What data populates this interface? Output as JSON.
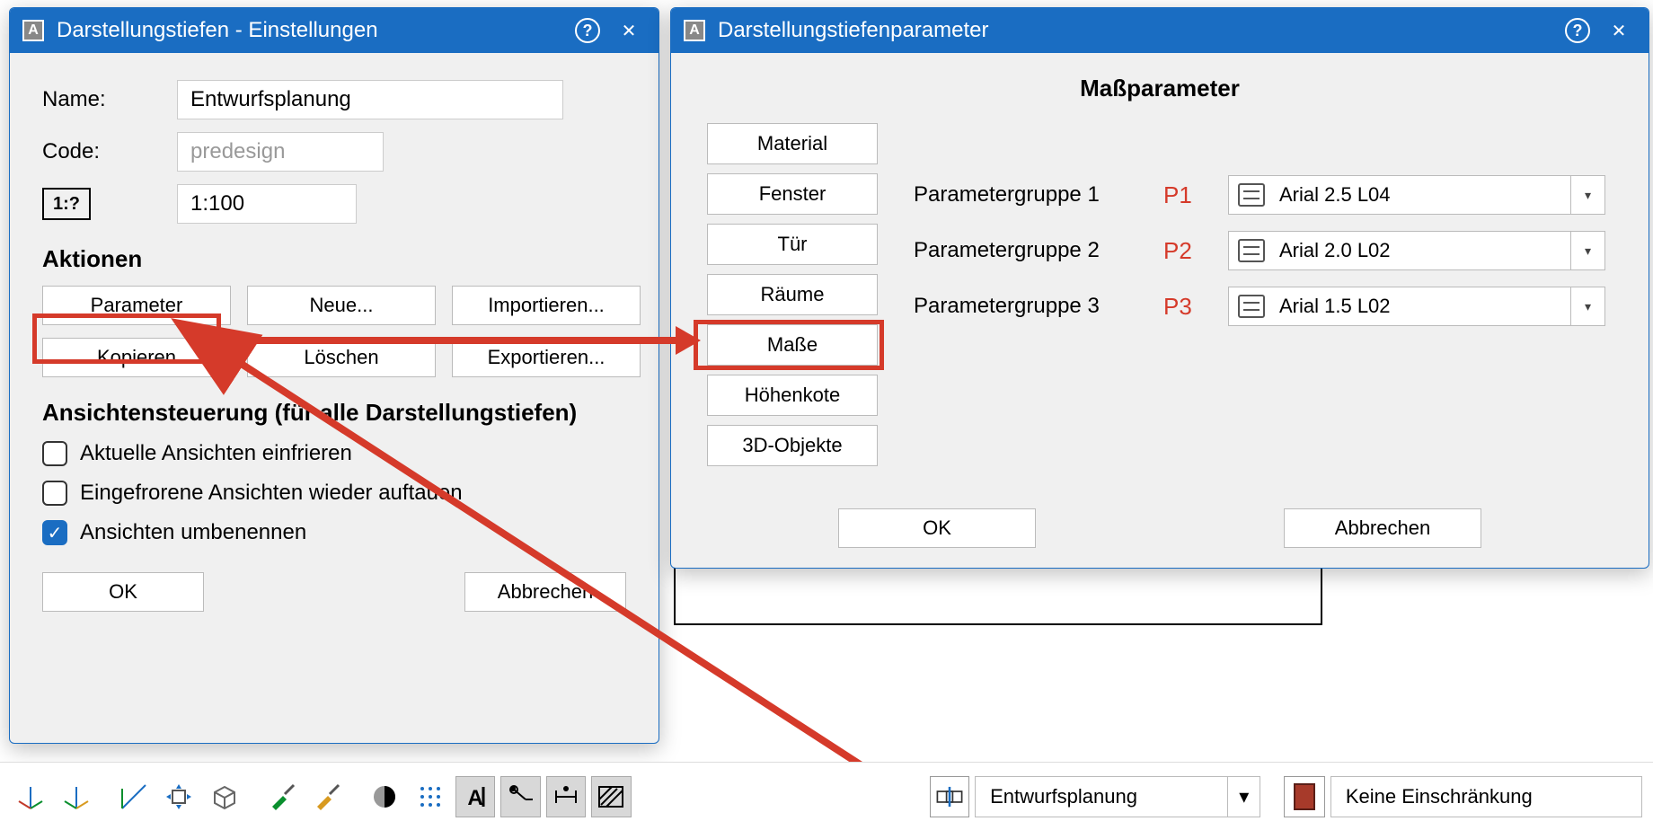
{
  "dialog1": {
    "title": "Darstellungstiefen - Einstellungen",
    "name_label": "Name:",
    "name_value": "Entwurfsplanung",
    "code_label": "Code:",
    "code_value": "predesign",
    "scale_icon": "1:?",
    "scale_value": "1:100",
    "actions_header": "Aktionen",
    "buttons": {
      "parameter": "Parameter",
      "neue": "Neue...",
      "importieren": "Importieren...",
      "kopieren": "Kopieren",
      "loeschen": "Löschen",
      "exportieren": "Exportieren..."
    },
    "view_header": "Ansichtensteuerung (für alle Darstellungstiefen)",
    "chk_freeze": "Aktuelle Ansichten einfrieren",
    "chk_unfreeze": "Eingefrorene Ansichten wieder auftauen",
    "chk_rename": "Ansichten umbenennen",
    "ok": "OK",
    "cancel": "Abbrechen"
  },
  "dialog2": {
    "title": "Darstellungstiefenparameter",
    "heading": "Maßparameter",
    "side": {
      "material": "Material",
      "fenster": "Fenster",
      "tuer": "Tür",
      "raeume": "Räume",
      "masse": "Maße",
      "hoehenkote": "Höhenkote",
      "objekte": "3D-Objekte"
    },
    "rows": [
      {
        "label": "Parametergruppe 1",
        "tag": "P1",
        "value": "Arial 2.5 L04"
      },
      {
        "label": "Parametergruppe 2",
        "tag": "P2",
        "value": "Arial 2.0 L02"
      },
      {
        "label": "Parametergruppe 3",
        "tag": "P3",
        "value": "Arial 1.5 L02"
      }
    ],
    "ok": "OK",
    "cancel": "Abbrechen"
  },
  "toolbar": {
    "dropdown1": "Entwurfsplanung",
    "dropdown2": "Keine Einschränkung"
  }
}
